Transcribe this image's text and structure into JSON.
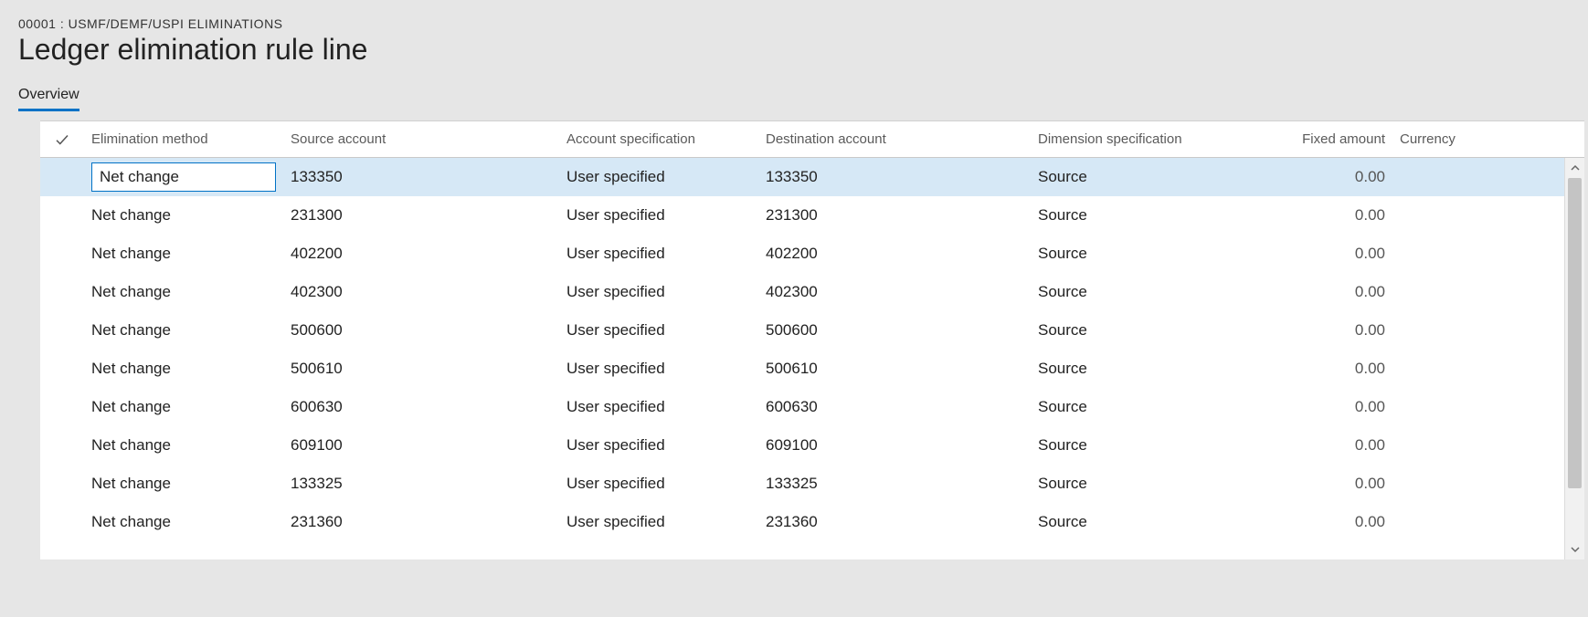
{
  "breadcrumb": "00001 : USMF/DEMF/USPI ELIMINATIONS",
  "page_title": "Ledger elimination rule line",
  "tabs": [
    {
      "label": "Overview",
      "active": true
    }
  ],
  "grid": {
    "columns": {
      "elimination_method": "Elimination method",
      "source_account": "Source account",
      "account_specification": "Account specification",
      "destination_account": "Destination account",
      "dimension_specification": "Dimension specification",
      "fixed_amount": "Fixed amount",
      "currency": "Currency"
    },
    "rows": [
      {
        "elimination_method": "Net change",
        "source_account": "133350",
        "account_specification": "User specified",
        "destination_account": "133350",
        "dimension_specification": "Source",
        "fixed_amount": "0.00",
        "currency": "",
        "selected": true
      },
      {
        "elimination_method": "Net change",
        "source_account": "231300",
        "account_specification": "User specified",
        "destination_account": "231300",
        "dimension_specification": "Source",
        "fixed_amount": "0.00",
        "currency": ""
      },
      {
        "elimination_method": "Net change",
        "source_account": "402200",
        "account_specification": "User specified",
        "destination_account": "402200",
        "dimension_specification": "Source",
        "fixed_amount": "0.00",
        "currency": ""
      },
      {
        "elimination_method": "Net change",
        "source_account": "402300",
        "account_specification": "User specified",
        "destination_account": "402300",
        "dimension_specification": "Source",
        "fixed_amount": "0.00",
        "currency": ""
      },
      {
        "elimination_method": "Net change",
        "source_account": "500600",
        "account_specification": "User specified",
        "destination_account": "500600",
        "dimension_specification": "Source",
        "fixed_amount": "0.00",
        "currency": ""
      },
      {
        "elimination_method": "Net change",
        "source_account": "500610",
        "account_specification": "User specified",
        "destination_account": "500610",
        "dimension_specification": "Source",
        "fixed_amount": "0.00",
        "currency": ""
      },
      {
        "elimination_method": "Net change",
        "source_account": "600630",
        "account_specification": "User specified",
        "destination_account": "600630",
        "dimension_specification": "Source",
        "fixed_amount": "0.00",
        "currency": ""
      },
      {
        "elimination_method": "Net change",
        "source_account": "609100",
        "account_specification": "User specified",
        "destination_account": "609100",
        "dimension_specification": "Source",
        "fixed_amount": "0.00",
        "currency": ""
      },
      {
        "elimination_method": "Net change",
        "source_account": "133325",
        "account_specification": "User specified",
        "destination_account": "133325",
        "dimension_specification": "Source",
        "fixed_amount": "0.00",
        "currency": ""
      },
      {
        "elimination_method": "Net change",
        "source_account": "231360",
        "account_specification": "User specified",
        "destination_account": "231360",
        "dimension_specification": "Source",
        "fixed_amount": "0.00",
        "currency": ""
      }
    ]
  }
}
